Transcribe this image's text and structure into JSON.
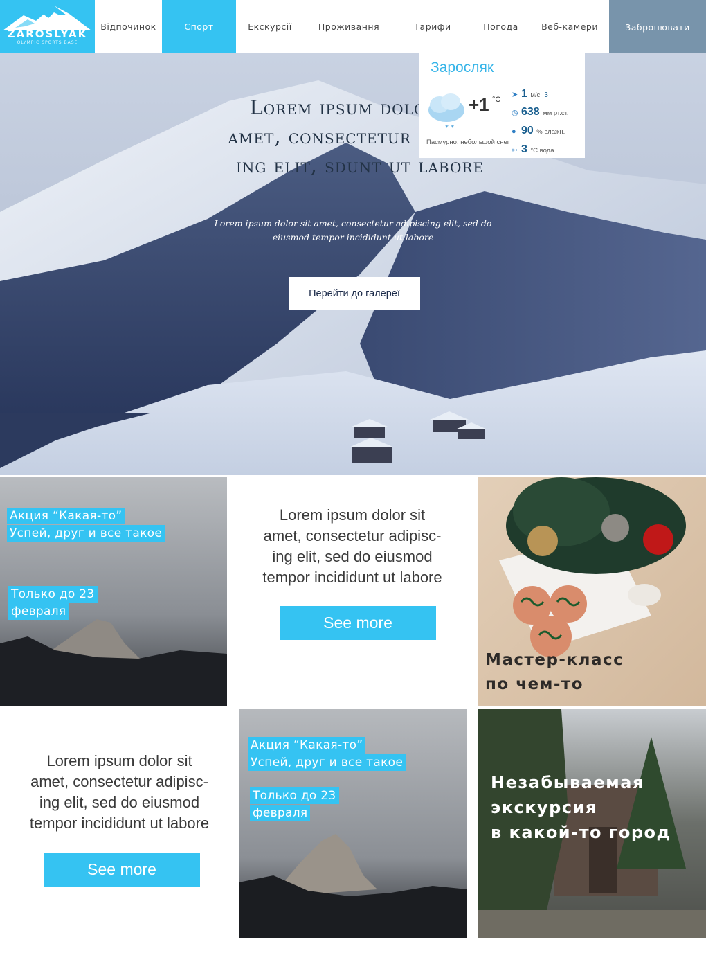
{
  "header": {
    "logo": {
      "name": "ZAROSLYAK",
      "tagline": "OLYMPIC SPORTS BASE"
    },
    "nav": [
      {
        "label": "Відпочинок",
        "active": false
      },
      {
        "label": "Спорт",
        "active": true
      },
      {
        "label": "Екскурсії",
        "active": false
      },
      {
        "label": "Проживання",
        "active": false
      },
      {
        "label": "Тарифи",
        "active": false
      },
      {
        "label": "Погода",
        "active": false
      },
      {
        "label": "Веб-камери",
        "active": false
      }
    ],
    "book_label": "Забронювати",
    "colors": {
      "accent": "#35c3f2",
      "book": "#7894ab"
    }
  },
  "hero": {
    "title": "Lorem ipsum dolor sit amet, consectetur adipisc-ing elit, sdunt ut labore",
    "title_lines": [
      "Lorem ipsum dolor sit",
      "amet, consectetur adipisc-",
      "ing elit, sdunt ut labore"
    ],
    "subtitle_lines": [
      "Lorem ipsum dolor sit amet, consectetur adipiscing elit, sed do",
      "eiusmod tempor incididunt ut labore"
    ],
    "gallery_button": "Перейти до галереї"
  },
  "weather": {
    "city": "Заросляк",
    "temp": "+1",
    "temp_unit": "°C",
    "condition": "Пасмурно, небольшой снег",
    "condition_icon": "cloud-snow-icon",
    "wind": {
      "value": "1",
      "unit": "м/с",
      "extra": "3",
      "icon": "wind-arrow-icon"
    },
    "pressure": {
      "value": "638",
      "unit": "мм рт.ст.",
      "icon": "gauge-icon"
    },
    "humidity": {
      "value": "90",
      "unit": "% влажн.",
      "icon": "drop-icon"
    },
    "water": {
      "value": "3",
      "unit": "°C вода",
      "icon": "fish-icon"
    }
  },
  "tiles": {
    "promo1": {
      "lines": [
        "Акция “Какая-то”",
        "Успей, друг и все такое"
      ],
      "date_lines": [
        "Только до 23",
        "февраля"
      ]
    },
    "text1": {
      "lines": [
        "Lorem ipsum dolor sit",
        "amet, consectetur adipisc-",
        "ing elit, sed do eiusmod",
        "tempor incididunt ut labore"
      ],
      "button": "See more"
    },
    "masterclass": {
      "lines": [
        "Мастер-класс",
        "по чем-то"
      ]
    },
    "text2": {
      "lines": [
        "Lorem ipsum dolor sit",
        "amet, consectetur adipisc-",
        "ing elit, sed do eiusmod",
        "tempor incididunt ut labore"
      ],
      "button": "See more"
    },
    "promo2": {
      "lines": [
        "Акция “Какая-то”",
        "Успей, друг и все такое"
      ],
      "date_lines": [
        "Только до 23",
        "февраля"
      ]
    },
    "excursion": {
      "lines": [
        "Незабываемая",
        "экскурсия",
        "в какой-то город"
      ]
    }
  }
}
